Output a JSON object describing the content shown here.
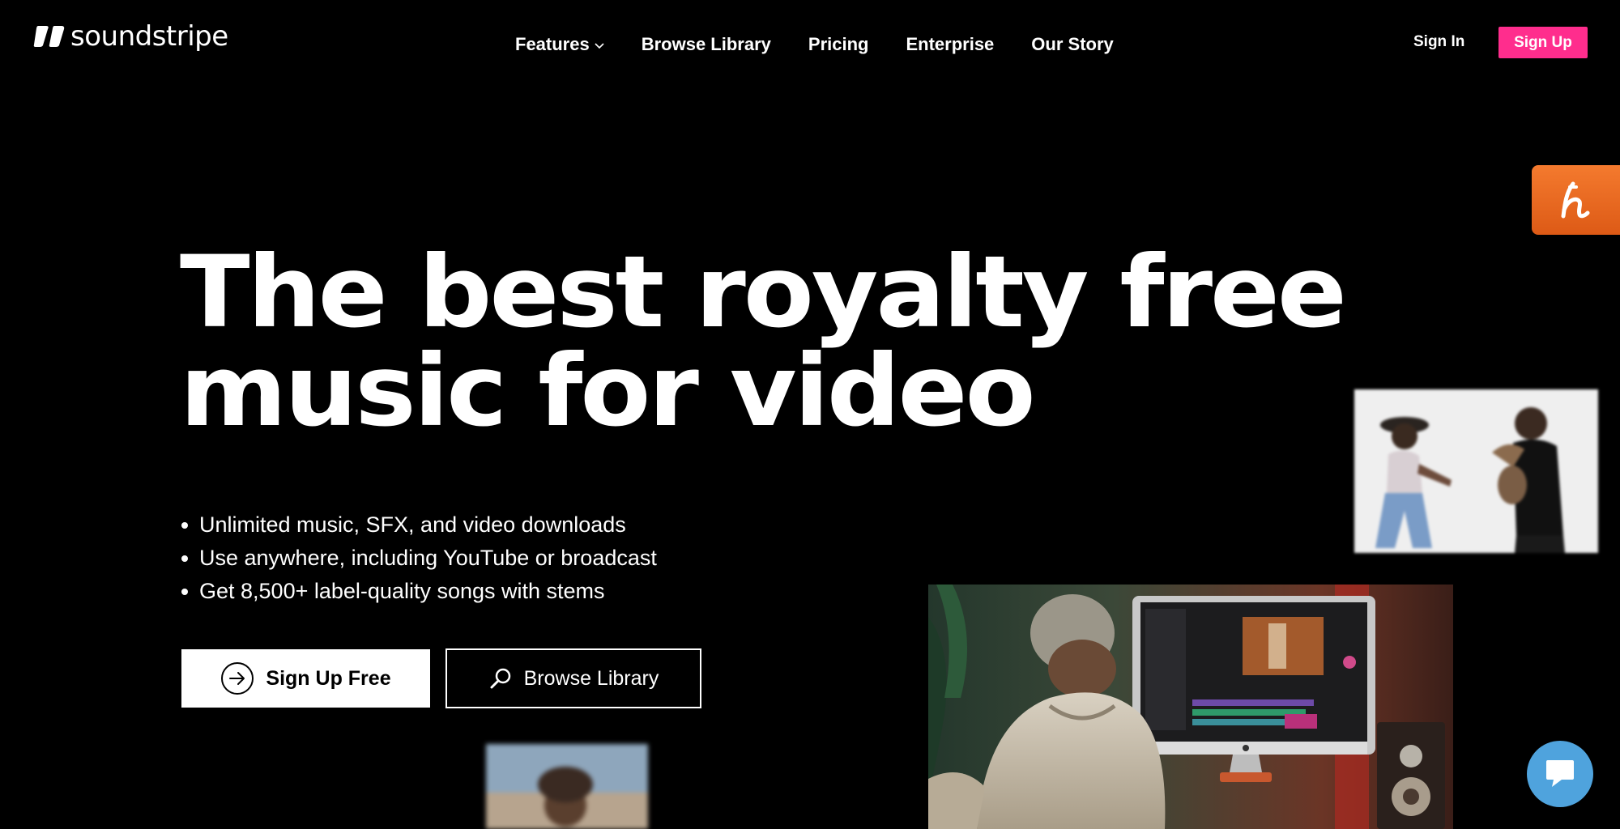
{
  "brand": {
    "name": "soundstripe",
    "accent_color": "#ff2d8d"
  },
  "nav": {
    "items": [
      {
        "label": "Features",
        "has_dropdown": true
      },
      {
        "label": "Browse Library"
      },
      {
        "label": "Pricing"
      },
      {
        "label": "Enterprise"
      },
      {
        "label": "Our Story"
      }
    ]
  },
  "header": {
    "sign_in": "Sign In",
    "sign_up": "Sign Up"
  },
  "side_badge": {
    "icon": "honey-h-icon",
    "color": "#e8671f"
  },
  "hero": {
    "title_line1": "The best royalty free",
    "title_line2": "music for video",
    "bullets": [
      "Unlimited music, SFX, and video downloads",
      "Use anywhere, including YouTube or broadcast",
      "Get 8,500+ label-quality songs with stems"
    ],
    "primary_cta": "Sign Up Free",
    "secondary_cta": "Browse Library"
  },
  "chat": {
    "icon": "chat-bubble-icon",
    "color": "#4fa3dd"
  }
}
